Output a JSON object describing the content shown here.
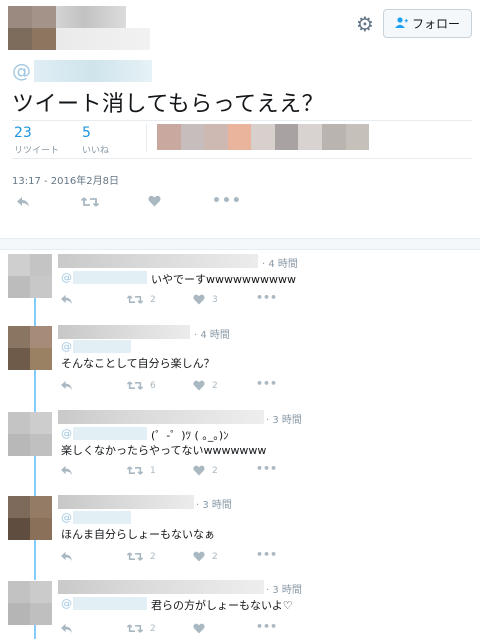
{
  "header": {
    "follow_label": "フォロー",
    "settings_icon": "gear-icon",
    "follow_icon": "person-plus-icon"
  },
  "tweet": {
    "at": "@",
    "text": "ツイート消してもらってええ？",
    "retweets_count": "23",
    "retweets_label": "リツイート",
    "likes_count": "5",
    "likes_label": "いいね",
    "timestamp": "13:17 - 2016年2月8日"
  },
  "replies": [
    {
      "time": "· 4 時間",
      "at": "@",
      "text": "いやでーすwwwwwwwwww",
      "retweets": "2",
      "likes": "3"
    },
    {
      "time": "· 4 時間",
      "at": "@",
      "text": "そんなことして自分ら楽しん？",
      "retweets": "6",
      "likes": "2"
    },
    {
      "time": "· 3 時間",
      "at": "@",
      "text_inline": "(゜-゜)ﾂ ( ｡_｡)ﾝ",
      "text": "楽しくなかったらやってないwwwwwww",
      "retweets": "1",
      "likes": "2"
    },
    {
      "time": "· 3 時間",
      "at": "@",
      "text": "ほんま自分らしょーもないなぁ",
      "retweets": "2",
      "likes": "2"
    },
    {
      "time": "· 3 時間",
      "at": "@",
      "text": "君らの方がしょーもないよ♡",
      "retweets": "2",
      "likes": ""
    }
  ],
  "colors": {
    "link_blue": "#1b95e0",
    "thread_blue": "#1da1f2",
    "muted": "#8899a6"
  }
}
